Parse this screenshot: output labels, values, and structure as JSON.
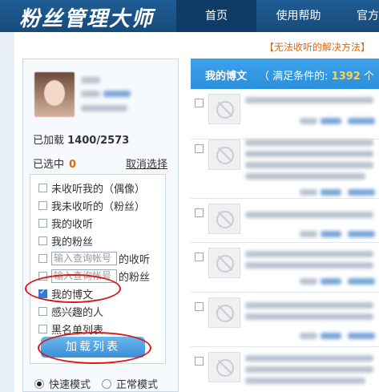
{
  "header": {
    "brand": "粉丝管理大师",
    "nav": [
      "首页",
      "使用帮助",
      "官方"
    ]
  },
  "notice": "【无法收听的解决方法】",
  "stats": {
    "loaded_label": "已加载",
    "loaded_value": "1400/2573",
    "selected_label": "已选中",
    "selected_count": "0",
    "unselect_label": "取消选择"
  },
  "options": {
    "not_following_me": "未收听我的（偶像）",
    "i_not_following": "我未收听的（粉丝）",
    "my_following": "我的收听",
    "my_fans": "我的粉丝",
    "account_placeholder": "输入查询帐号",
    "following_suffix": "的收听",
    "fans_suffix": "的粉丝",
    "my_posts": "我的博文",
    "interested": "感兴趣的人",
    "blacklist": "黑名单列表"
  },
  "load_button": "加载列表",
  "modes": {
    "fast": "快速模式",
    "normal": "正常模式"
  },
  "list": {
    "title": "我的博文",
    "condition_prefix": "（ 满足条件的:",
    "count": "1392",
    "condition_suffix": "个｜过"
  },
  "colors": {
    "header_bg": "#1f5d95",
    "accent_blue": "#2b8fdb",
    "orange": "#e06a10",
    "highlight_ring": "#d61a1a"
  }
}
